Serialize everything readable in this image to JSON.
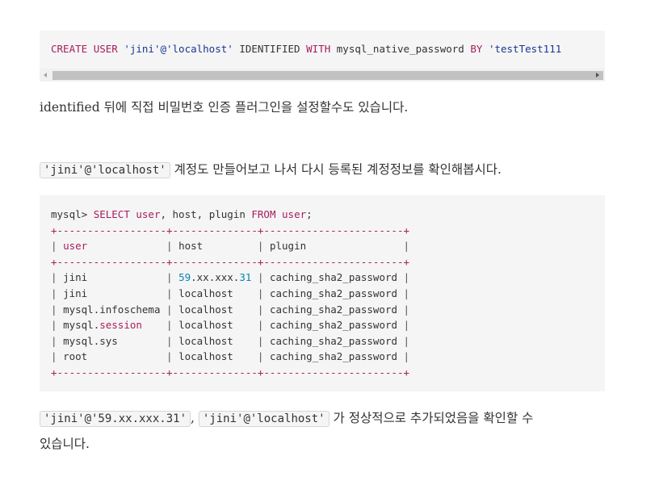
{
  "code_block_1": {
    "kw_create": "CREATE",
    "kw_user": "USER",
    "user_str": "'jini'@'localhost'",
    "identified": "IDENTIFIED",
    "kw_with": "WITH",
    "plugin": "mysql_native_password",
    "kw_by": "BY",
    "password_str": "'testTest111"
  },
  "paragraph_1": "identified 뒤에 직접 비밀번호 인증 플러그인을 설정할수도 있습니다.",
  "paragraph_2": {
    "code": "'jini'@'localhost'",
    "text": " 계정도 만들어보고 나서 다시 등록된 계정정보를 확인해봅시다."
  },
  "code_block_2": {
    "prompt": "mysql> ",
    "kw_select": "SELECT",
    "kw_user": "user",
    "mid": ", host, plugin ",
    "kw_from": "FROM",
    "space": " ",
    "kw_user2": "user",
    "end": ";",
    "border": "+------------------+--------------+-----------------------+",
    "headers": [
      "user",
      "host",
      "plugin"
    ],
    "rows": [
      [
        "jini",
        "59.xx.xxx.31",
        "caching_sha2_password"
      ],
      [
        "jini",
        "localhost",
        "caching_sha2_password"
      ],
      [
        "mysql.infoschema",
        "localhost",
        "caching_sha2_password"
      ],
      [
        "mysql.session",
        "localhost",
        "caching_sha2_password"
      ],
      [
        "mysql.sys",
        "localhost",
        "caching_sha2_password"
      ],
      [
        "root",
        "localhost",
        "caching_sha2_password"
      ]
    ]
  },
  "paragraph_3": {
    "code_a": "'jini'@'59.xx.xxx.31'",
    "sep": ", ",
    "code_b": "'jini'@'localhost'",
    "text": " 가 정상적으로 추가되었음을 확인할 수",
    "text2": "있습니다."
  }
}
